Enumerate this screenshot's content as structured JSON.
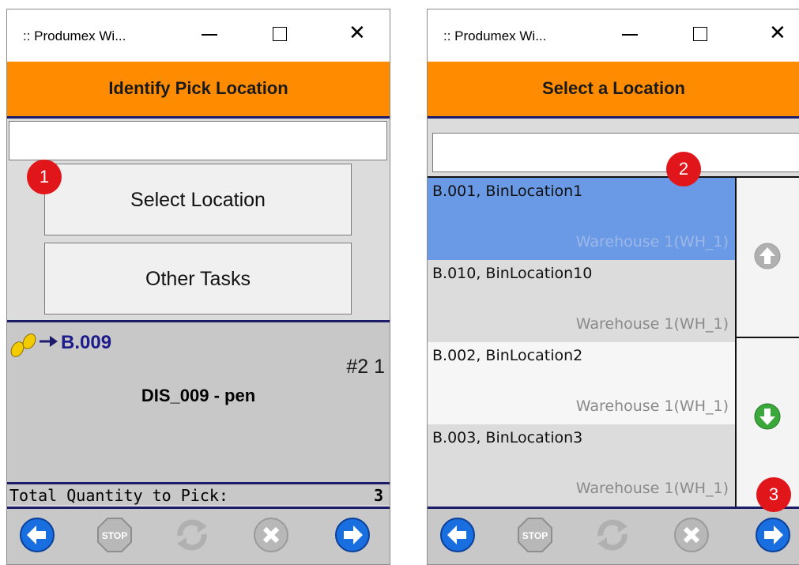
{
  "left_window": {
    "title": ":: Produmex Wi...",
    "header": "Identify Pick Location",
    "scan_value": "",
    "buttons": {
      "select_location": "Select Location",
      "other_tasks": "Other Tasks"
    },
    "pick": {
      "location": "B.009",
      "seq": "#2 1",
      "item": "DIS_009 - pen"
    },
    "total": {
      "label": "Total Quantity to Pick:",
      "value": "3"
    },
    "nav": [
      "back-icon",
      "stop-icon",
      "refresh-icon",
      "cancel-icon",
      "forward-icon"
    ]
  },
  "right_window": {
    "title": ":: Produmex Wi...",
    "header": "Select a Location",
    "scan_value": "",
    "locations": [
      {
        "code": "B.001, BinLocation1",
        "warehouse": "Warehouse 1(WH_1)",
        "selected": true
      },
      {
        "code": "B.010, BinLocation10",
        "warehouse": "Warehouse 1(WH_1)",
        "selected": false
      },
      {
        "code": "B.002, BinLocation2",
        "warehouse": "Warehouse 1(WH_1)",
        "selected": false
      },
      {
        "code": "B.003, BinLocation3",
        "warehouse": "Warehouse 1(WH_1)",
        "selected": false
      }
    ],
    "nav": [
      "back-icon",
      "stop-icon",
      "refresh-icon",
      "cancel-icon",
      "forward-icon"
    ]
  },
  "callouts": [
    "1",
    "2",
    "3"
  ],
  "colors": {
    "header": "#ff8c00",
    "separator": "#1c1c6b",
    "selected_row": "#6a9ae6",
    "badge": "#e0161b",
    "nav_blue": "#1a6fe0"
  }
}
